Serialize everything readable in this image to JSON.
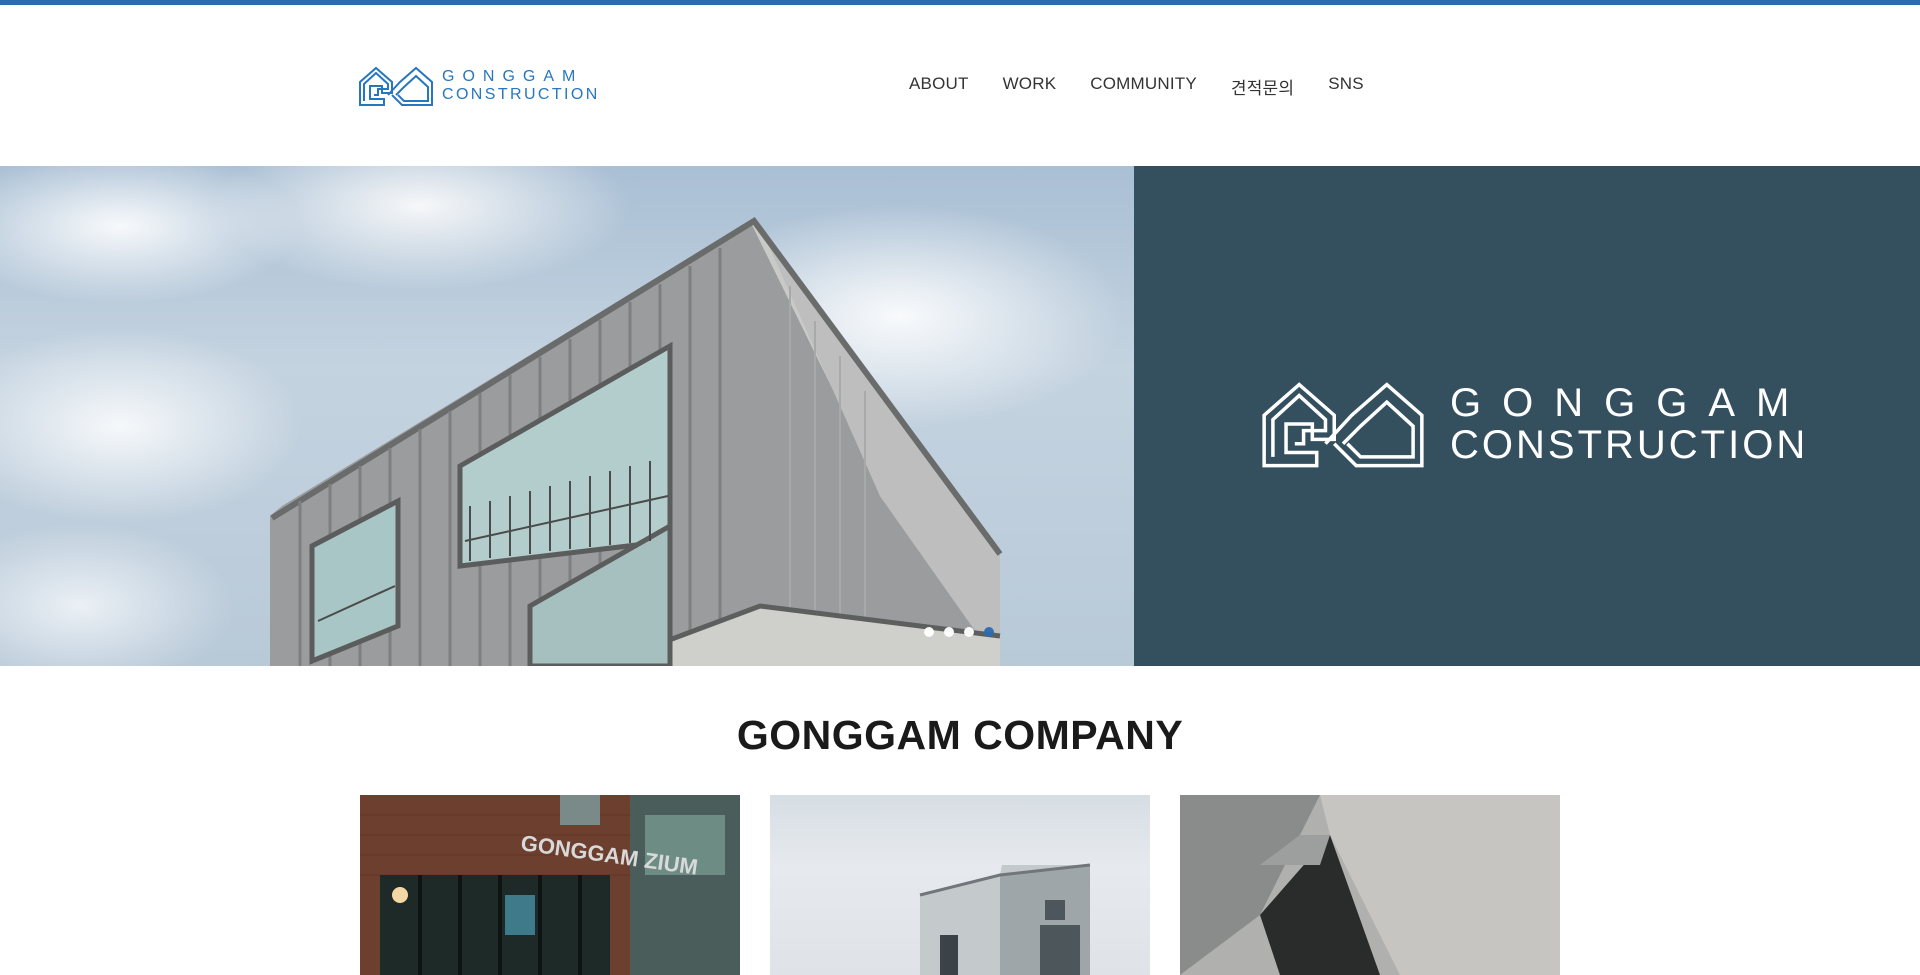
{
  "colors": {
    "accent": "#2b6cb0",
    "logo_blue": "#2777c0",
    "hero_panel": "#34505e"
  },
  "header": {
    "logo": {
      "icon": "gonggam-house-logo-icon",
      "line1": "GONGGAM",
      "line2": "CONSTRUCTION"
    },
    "nav": [
      {
        "label": "ABOUT"
      },
      {
        "label": "WORK"
      },
      {
        "label": "COMMUNITY"
      },
      {
        "label": "견적문의"
      },
      {
        "label": "SNS"
      }
    ]
  },
  "hero": {
    "photo": "modern-building-photo",
    "logo": {
      "icon": "gonggam-house-logo-icon",
      "line1": "GONGGAM",
      "line2": "CONSTRUCTION"
    },
    "slider": {
      "count": 4,
      "active_index": 4
    }
  },
  "company": {
    "title": "GONGGAM COMPANY",
    "cards": [
      {
        "image": "gonggam-zium-storefront-photo",
        "sign_text": "GONGGAM ZIUM"
      },
      {
        "image": "white-building-photo"
      },
      {
        "image": "concrete-architecture-photo"
      }
    ]
  }
}
